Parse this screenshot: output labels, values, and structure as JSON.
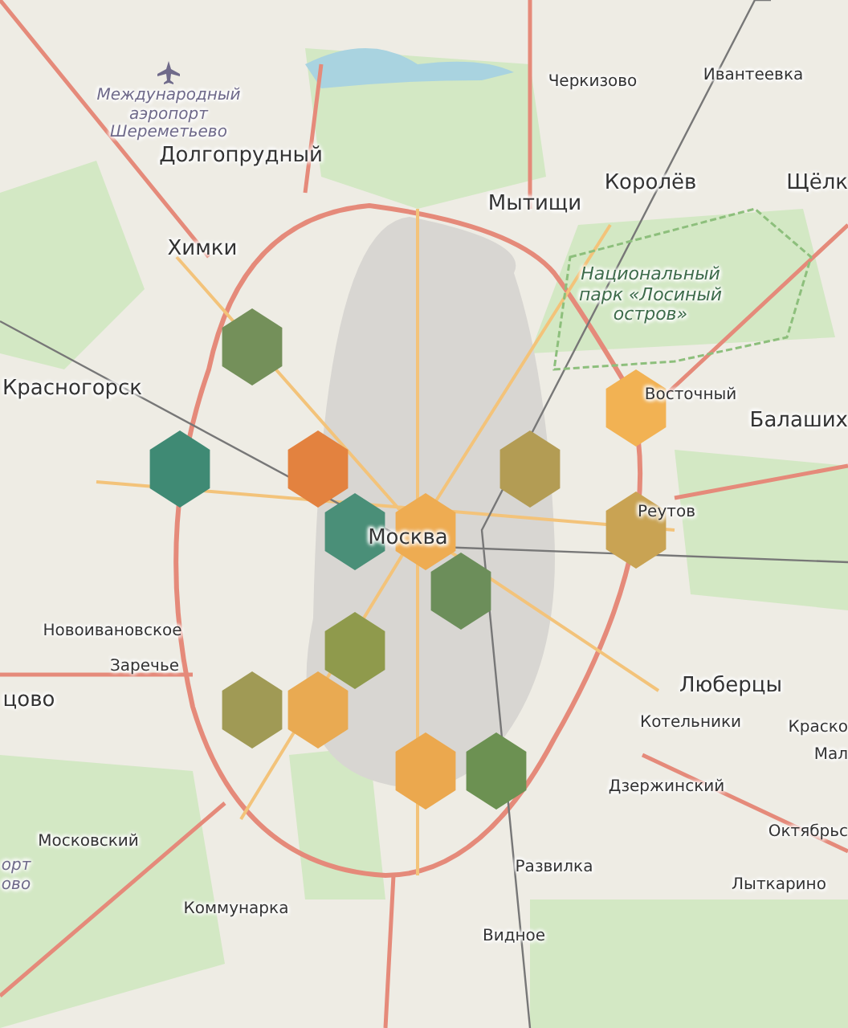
{
  "map": {
    "labels": [
      {
        "text": "Международный\nаэропорт\nШереметьево",
        "kind": "poi"
      },
      {
        "text": "Черкизово",
        "kind": "town"
      },
      {
        "text": "Ивантеевка",
        "kind": "town"
      },
      {
        "text": "Долгопрудный",
        "kind": "city"
      },
      {
        "text": "Королёв",
        "kind": "city"
      },
      {
        "text": "Мытищи",
        "kind": "city"
      },
      {
        "text": "Щёлк",
        "kind": "city"
      },
      {
        "text": "Химки",
        "kind": "city"
      },
      {
        "text": "Национальный\nпарк «Лосиный\nостров»",
        "kind": "park"
      },
      {
        "text": "Красногорск",
        "kind": "city"
      },
      {
        "text": "Восточный",
        "kind": "town"
      },
      {
        "text": "Балаших",
        "kind": "city"
      },
      {
        "text": "Реутов",
        "kind": "town"
      },
      {
        "text": "Москва",
        "kind": "city"
      },
      {
        "text": "Новоивановское",
        "kind": "town"
      },
      {
        "text": "Заречье",
        "kind": "town"
      },
      {
        "text": "Люберцы",
        "kind": "city"
      },
      {
        "text": "цово",
        "kind": "city"
      },
      {
        "text": "Котельники",
        "kind": "town"
      },
      {
        "text": "Краско",
        "kind": "town"
      },
      {
        "text": "Мал",
        "kind": "town"
      },
      {
        "text": "Дзержинский",
        "kind": "town"
      },
      {
        "text": "Октябрьс",
        "kind": "town"
      },
      {
        "text": "Московский",
        "kind": "town"
      },
      {
        "text": "орт\nово",
        "kind": "poi"
      },
      {
        "text": "Развилка",
        "kind": "town"
      },
      {
        "text": "Лыткарино",
        "kind": "town"
      },
      {
        "text": "Коммунарка",
        "kind": "town"
      },
      {
        "text": "Видное",
        "kind": "town"
      }
    ],
    "hexagons": [
      {
        "color": "#74905a"
      },
      {
        "color": "#3f8a74"
      },
      {
        "color": "#e3823f"
      },
      {
        "color": "#4a8f78"
      },
      {
        "color": "#eeac52"
      },
      {
        "color": "#b39c54"
      },
      {
        "color": "#f2b253"
      },
      {
        "color": "#c9a353"
      },
      {
        "color": "#6c8e5a"
      },
      {
        "color": "#8f9a4c"
      },
      {
        "color": "#a09a55"
      },
      {
        "color": "#e9aa52"
      },
      {
        "color": "#eba84e"
      },
      {
        "color": "#6c9152"
      }
    ]
  }
}
